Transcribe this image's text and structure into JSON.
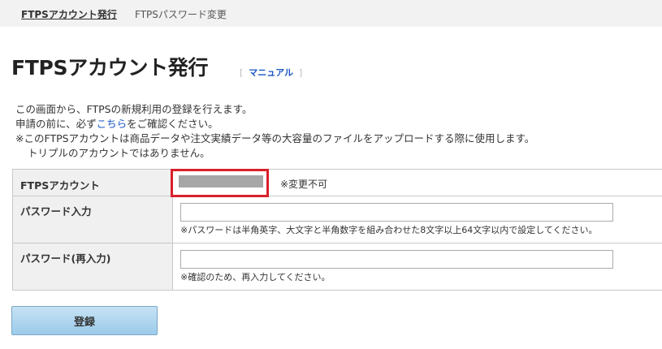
{
  "tabs": [
    {
      "label": "FTPSアカウント発行",
      "active": true
    },
    {
      "label": "FTPSパスワード変更",
      "active": false
    }
  ],
  "title": "FTPSアカウント発行",
  "manual": {
    "open": "[",
    "label": "マニュアル",
    "close": "]"
  },
  "description": {
    "line1": "この画面から、FTPSの新規利用の登録を行えます。",
    "line2_prefix": "申請の前に、必ず",
    "line2_link": "こちら",
    "line2_suffix": "をご確認ください。",
    "line3": "※このFTPSアカウントは商品データや注文実績データ等の大容量のファイルをアップロードする際に使用します。",
    "line4": "トリプルのアカウントではありません。"
  },
  "form": {
    "account": {
      "label": "FTPSアカウント",
      "note": "※変更不可"
    },
    "password": {
      "label": "パスワード入力",
      "value": "",
      "hint": "※パスワードは半角英字、大文字と半角数字を組み合わせた8文字以上64文字以内で設定してください。"
    },
    "password_confirm": {
      "label": "パスワード(再入力)",
      "value": "",
      "hint": "※確認のため、再入力してください。"
    }
  },
  "submit_label": "登録",
  "colors": {
    "link": "#1a56c4",
    "highlight": "#d9202a",
    "button_top": "#c6e2f4",
    "button_bottom": "#9ccbea"
  }
}
